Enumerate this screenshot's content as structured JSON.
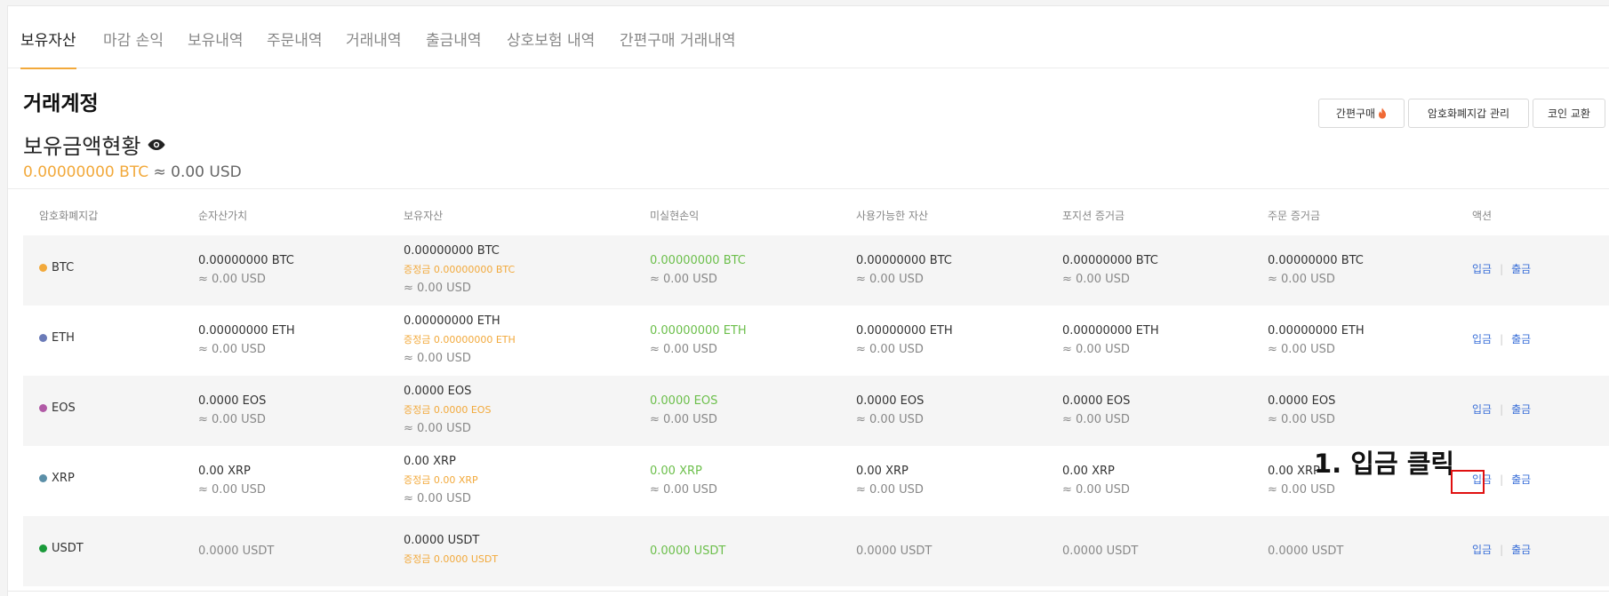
{
  "tabs": [
    "보유자산",
    "마감 손익",
    "보유내역",
    "주문내역",
    "거래내역",
    "출금내역",
    "상호보험 내역",
    "간편구매 거래내역"
  ],
  "section_title": "거래계정",
  "holdings_title": "보유금액현황",
  "balance": {
    "btc": "0.00000000 BTC",
    "approx": "≈ 0.00 USD"
  },
  "buttons": {
    "quick_buy": "간편구매",
    "wallet_manage": "암호화폐지갑 관리",
    "coin_exchange": "코인 교환"
  },
  "table_headers": [
    "암호화폐지갑",
    "순자산가치",
    "보유자산",
    "미실현손익",
    "사용가능한 자산",
    "포지션 증거금",
    "주문 증거금",
    "액션"
  ],
  "rows": [
    {
      "coin": "BTC",
      "color": "#f2a93b",
      "net": "0.00000000 BTC",
      "net_usd": "≈ 0.00 USD",
      "hold": "0.00000000 BTC",
      "hold_margin": "증정금 0.00000000 BTC",
      "hold_usd": "≈ 0.00 USD",
      "pnl": "0.00000000 BTC",
      "pnl_usd": "≈ 0.00 USD",
      "avail": "0.00000000 BTC",
      "avail_usd": "≈ 0.00 USD",
      "pos": "0.00000000 BTC",
      "pos_usd": "≈ 0.00 USD",
      "order": "0.00000000 BTC",
      "order_usd": "≈ 0.00 USD"
    },
    {
      "coin": "ETH",
      "color": "#6b7bb8",
      "net": "0.00000000 ETH",
      "net_usd": "≈ 0.00 USD",
      "hold": "0.00000000 ETH",
      "hold_margin": "증정금 0.00000000 ETH",
      "hold_usd": "≈ 0.00 USD",
      "pnl": "0.00000000 ETH",
      "pnl_usd": "≈ 0.00 USD",
      "avail": "0.00000000 ETH",
      "avail_usd": "≈ 0.00 USD",
      "pos": "0.00000000 ETH",
      "pos_usd": "≈ 0.00 USD",
      "order": "0.00000000 ETH",
      "order_usd": "≈ 0.00 USD"
    },
    {
      "coin": "EOS",
      "color": "#b15aa6",
      "net": "0.0000 EOS",
      "net_usd": "≈ 0.00 USD",
      "hold": "0.0000 EOS",
      "hold_margin": "증정금 0.0000 EOS",
      "hold_usd": "≈ 0.00 USD",
      "pnl": "0.0000 EOS",
      "pnl_usd": "≈ 0.00 USD",
      "avail": "0.0000 EOS",
      "avail_usd": "≈ 0.00 USD",
      "pos": "0.0000 EOS",
      "pos_usd": "≈ 0.00 USD",
      "order": "0.0000 EOS",
      "order_usd": "≈ 0.00 USD"
    },
    {
      "coin": "XRP",
      "color": "#5b8fa8",
      "net": "0.00 XRP",
      "net_usd": "≈ 0.00 USD",
      "hold": "0.00 XRP",
      "hold_margin": "증정금 0.00 XRP",
      "hold_usd": "≈ 0.00 USD",
      "pnl": "0.00 XRP",
      "pnl_usd": "≈ 0.00 USD",
      "avail": "0.00 XRP",
      "avail_usd": "≈ 0.00 USD",
      "pos": "0.00 XRP",
      "pos_usd": "≈ 0.00 USD",
      "order": "0.00 XRP",
      "order_usd": "≈ 0.00 USD"
    },
    {
      "coin": "USDT",
      "color": "#1a9a3a",
      "net": "0.0000 USDT",
      "net_usd": "",
      "hold": "0.0000 USDT",
      "hold_margin": "증정금 0.0000 USDT",
      "hold_usd": "",
      "pnl": "0.0000 USDT",
      "pnl_usd": "",
      "avail": "0.0000 USDT",
      "avail_usd": "",
      "pos": "0.0000 USDT",
      "pos_usd": "",
      "order": "0.0000 USDT",
      "order_usd": ""
    }
  ],
  "actions": {
    "deposit": "입금",
    "withdraw": "출금",
    "separator": "|"
  },
  "annotation": "1. 입금 클릭"
}
